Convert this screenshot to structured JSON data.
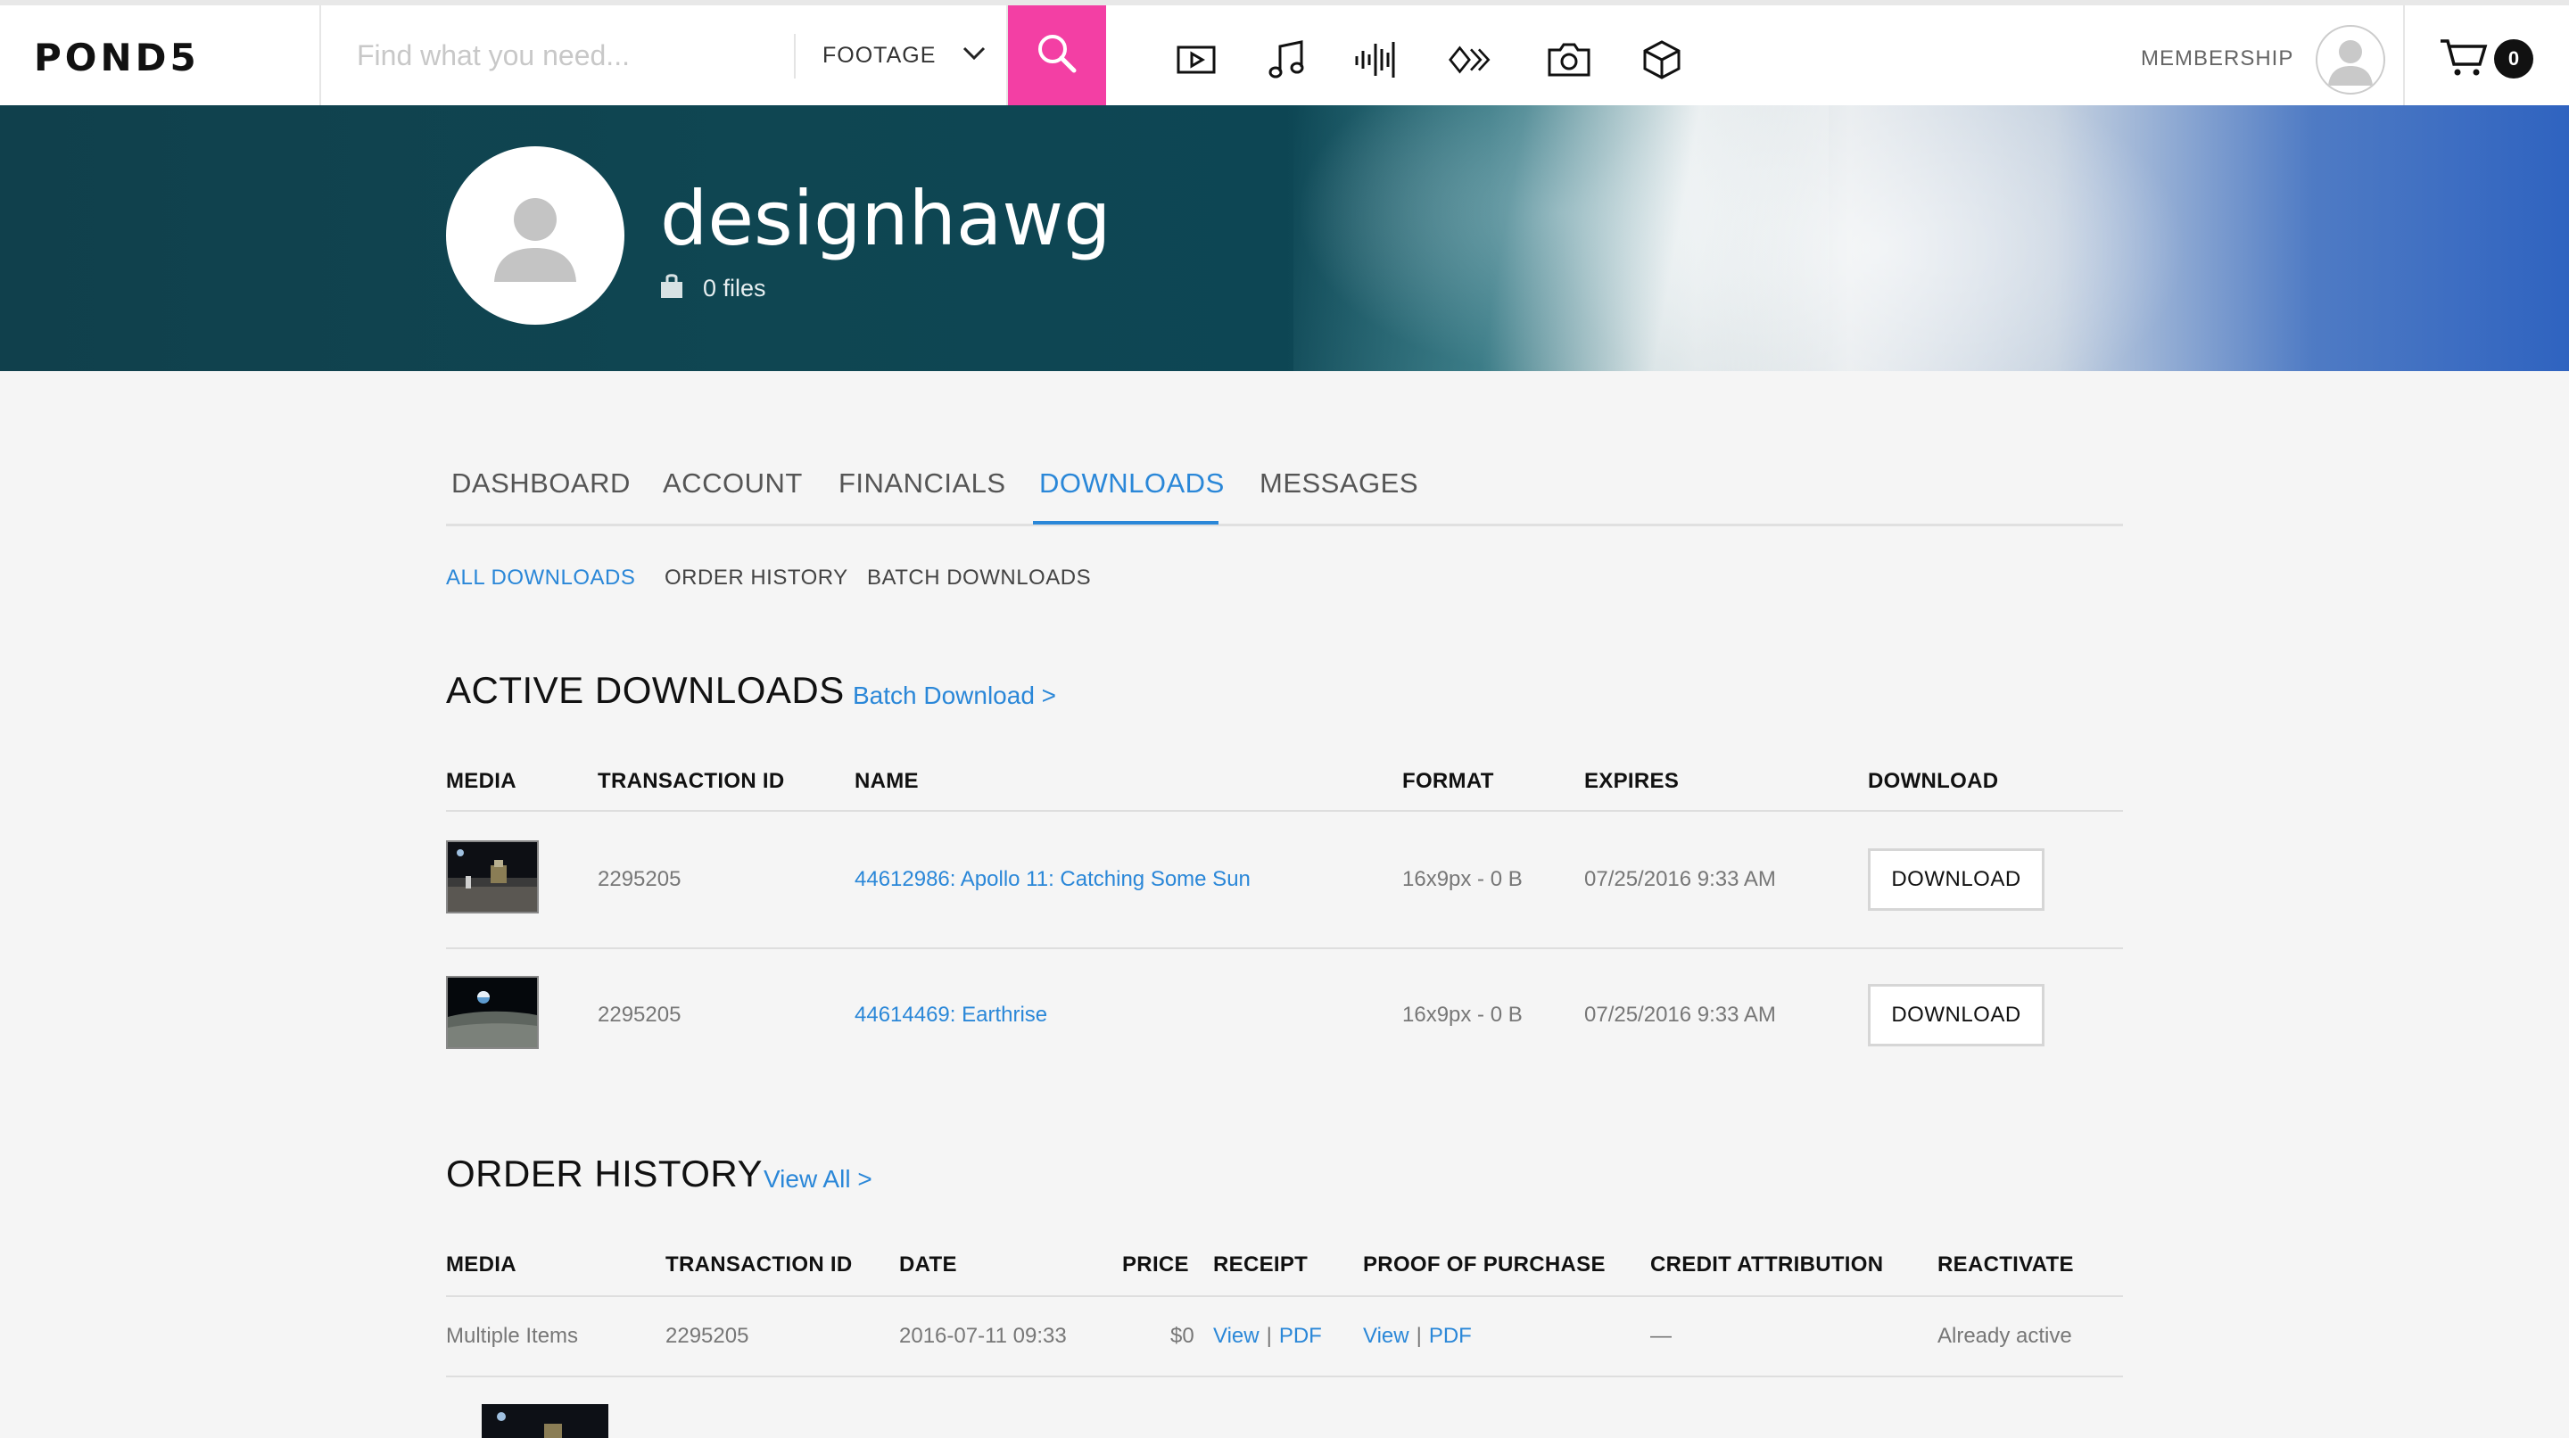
{
  "header": {
    "logo": "POND5",
    "search_placeholder": "Find what you need...",
    "category": "FOOTAGE",
    "media_icons": [
      "video-icon",
      "music-icon",
      "sound-effects-icon",
      "after-effects-icon",
      "photo-icon",
      "3d-icon"
    ],
    "membership": "MEMBERSHIP",
    "cart_count": "0"
  },
  "profile": {
    "username": "designhawg",
    "files": "0 files"
  },
  "tabs": [
    {
      "label": "DASHBOARD",
      "active": false
    },
    {
      "label": "ACCOUNT",
      "active": false
    },
    {
      "label": "FINANCIALS",
      "active": false
    },
    {
      "label": "DOWNLOADS",
      "active": true
    },
    {
      "label": "MESSAGES",
      "active": false
    }
  ],
  "subtabs": [
    {
      "label": "ALL DOWNLOADS",
      "active": true
    },
    {
      "label": "ORDER HISTORY",
      "active": false
    },
    {
      "label": "BATCH DOWNLOADS",
      "active": false
    }
  ],
  "active_downloads": {
    "title": "ACTIVE DOWNLOADS",
    "link": "Batch Download >",
    "columns": [
      "MEDIA",
      "TRANSACTION ID",
      "NAME",
      "FORMAT",
      "EXPIRES",
      "DOWNLOAD"
    ],
    "rows": [
      {
        "transaction_id": "2295205",
        "name": "44612986: Apollo 11: Catching Some Sun",
        "format": "16x9px - 0 B",
        "expires": "07/25/2016 9:33 AM",
        "button": "DOWNLOAD"
      },
      {
        "transaction_id": "2295205",
        "name": "44614469: Earthrise",
        "format": "16x9px - 0 B",
        "expires": "07/25/2016 9:33 AM",
        "button": "DOWNLOAD"
      }
    ]
  },
  "order_history": {
    "title": "ORDER HISTORY",
    "link": "View All >",
    "columns": [
      "MEDIA",
      "TRANSACTION ID",
      "DATE",
      "PRICE",
      "RECEIPT",
      "PROOF OF PURCHASE",
      "CREDIT ATTRIBUTION",
      "REACTIVATE"
    ],
    "rows": [
      {
        "media": "Multiple Items",
        "transaction_id": "2295205",
        "date": "2016-07-11 09:33",
        "price": "$0",
        "receipt_view": "View",
        "receipt_pdf": "PDF",
        "proof_view": "View",
        "proof_pdf": "PDF",
        "credit": "—",
        "reactivate": "Already active"
      }
    ]
  }
}
